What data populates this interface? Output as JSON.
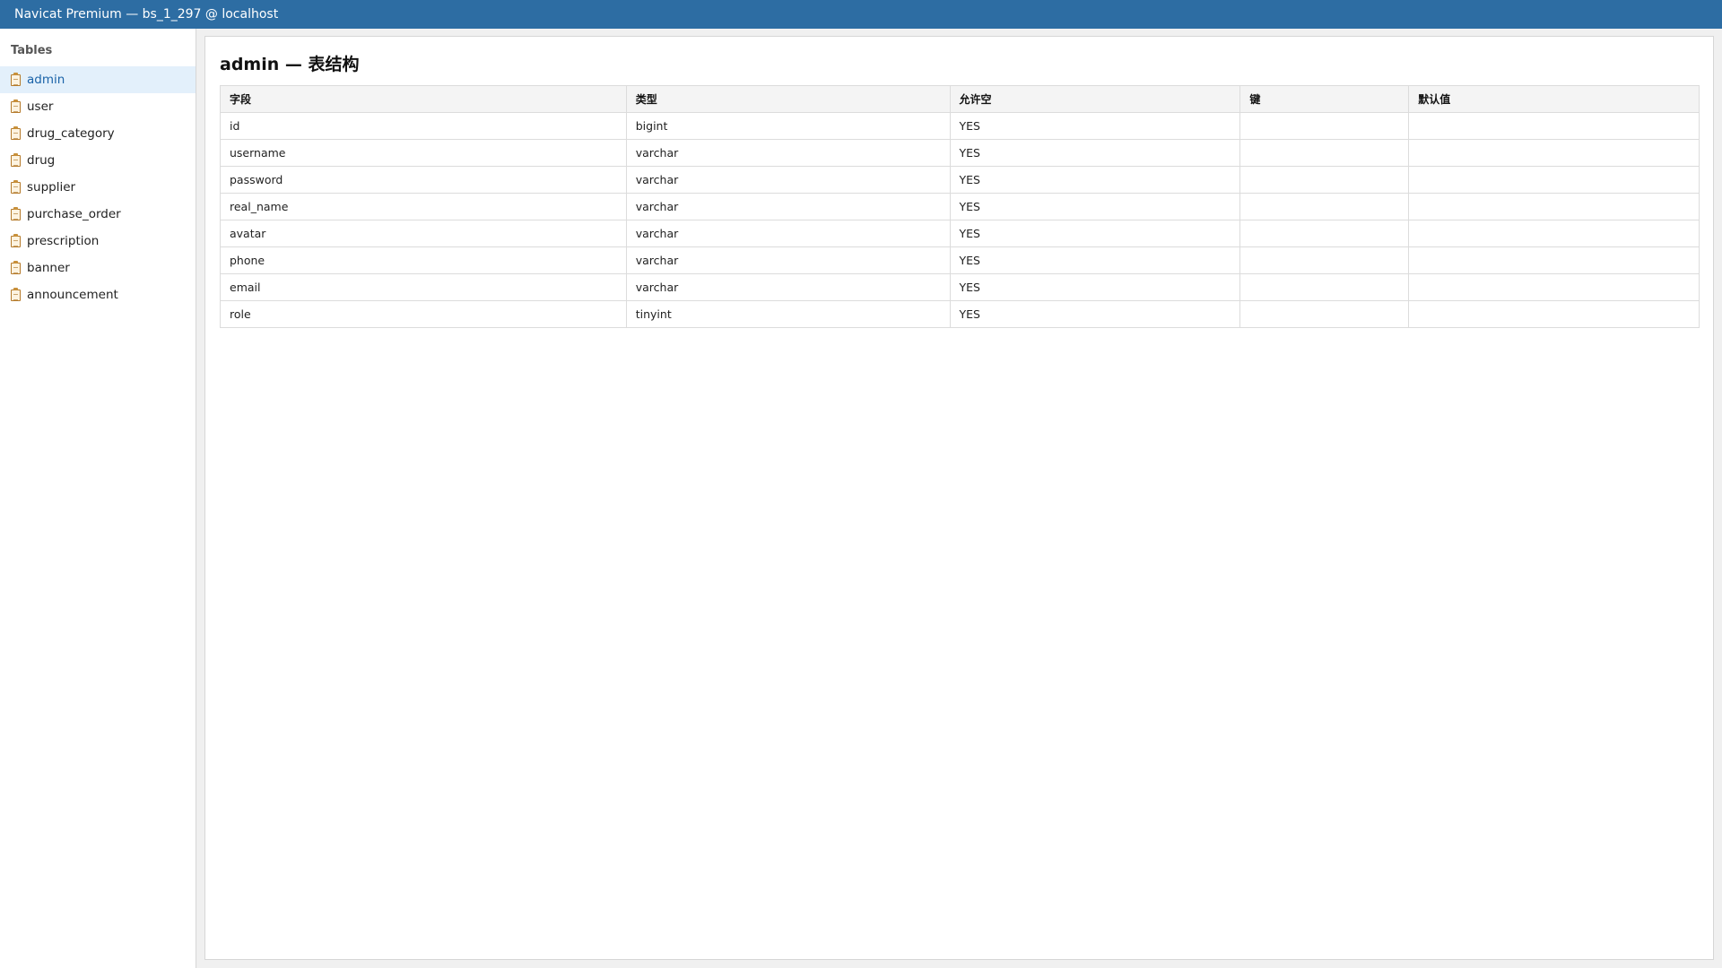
{
  "window": {
    "title": "Navicat Premium — bs_1_297 @ localhost"
  },
  "sidebar": {
    "heading": "Tables",
    "items": [
      {
        "label": "admin",
        "icon": "table-icon",
        "active": true
      },
      {
        "label": "user",
        "icon": "table-icon"
      },
      {
        "label": "drug_category",
        "icon": "table-icon"
      },
      {
        "label": "drug",
        "icon": "table-icon"
      },
      {
        "label": "supplier",
        "icon": "table-icon"
      },
      {
        "label": "purchase_order",
        "icon": "table-icon"
      },
      {
        "label": "prescription",
        "icon": "table-icon"
      },
      {
        "label": "banner",
        "icon": "table-icon"
      },
      {
        "label": "announcement",
        "icon": "table-icon"
      }
    ]
  },
  "main": {
    "title": "admin — 表结构",
    "columns": [
      "字段",
      "类型",
      "允许空",
      "键",
      "默认值"
    ],
    "rows": [
      [
        "id",
        "bigint",
        "YES",
        "",
        ""
      ],
      [
        "username",
        "varchar",
        "YES",
        "",
        ""
      ],
      [
        "password",
        "varchar",
        "YES",
        "",
        ""
      ],
      [
        "real_name",
        "varchar",
        "YES",
        "",
        ""
      ],
      [
        "avatar",
        "varchar",
        "YES",
        "",
        ""
      ],
      [
        "phone",
        "varchar",
        "YES",
        "",
        ""
      ],
      [
        "email",
        "varchar",
        "YES",
        "",
        ""
      ],
      [
        "role",
        "tinyint",
        "YES",
        "",
        ""
      ]
    ]
  },
  "colors": {
    "titlebar": "#2d6da3",
    "active_item_bg": "#e3f0fb",
    "active_item_text": "#1a63a8"
  }
}
